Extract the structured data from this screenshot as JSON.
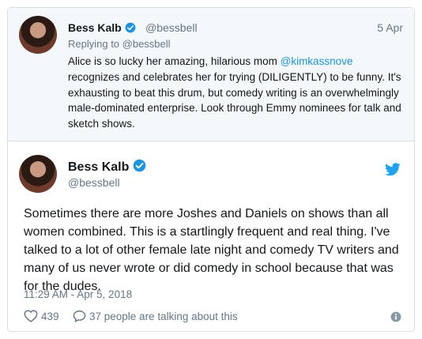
{
  "parent_tweet": {
    "name": "Bess Kalb",
    "handle": "@bessbell",
    "date": "5 Apr",
    "replying_to": "Replying to @bessbell",
    "text_before_mention": "Alice is so lucky her amazing, hilarious mom ",
    "mention": "@kimkassnove",
    "text_after_mention": " recognizes and celebrates her for trying (DILIGENTLY) to be funny. It's exhausting to beat this drum, but comedy writing is an overwhelmingly male-dominated enterprise. Look through Emmy nominees for talk and sketch shows."
  },
  "main_tweet": {
    "name": "Bess Kalb",
    "handle": "@bessbell",
    "text": "Sometimes there are more Joshes and Daniels on shows than all women combined. This is a startlingly frequent and real thing. I've talked to a lot of other female late night and comedy TV writers and many of us never wrote or did comedy in school because that was for the dudes.",
    "timestamp": "11:29 AM - Apr 5, 2018",
    "likes": "439",
    "talking": "37 people are talking about this"
  },
  "icons": {
    "verified": "verified-badge-icon",
    "bird": "twitter-bird-icon",
    "heart": "heart-icon",
    "comment": "comment-bubble-icon",
    "info": "info-icon"
  },
  "colors": {
    "accent": "#1b95e0",
    "muted": "#657786",
    "border": "#d9dfe3",
    "quote_bg": "#f5f8fa"
  }
}
